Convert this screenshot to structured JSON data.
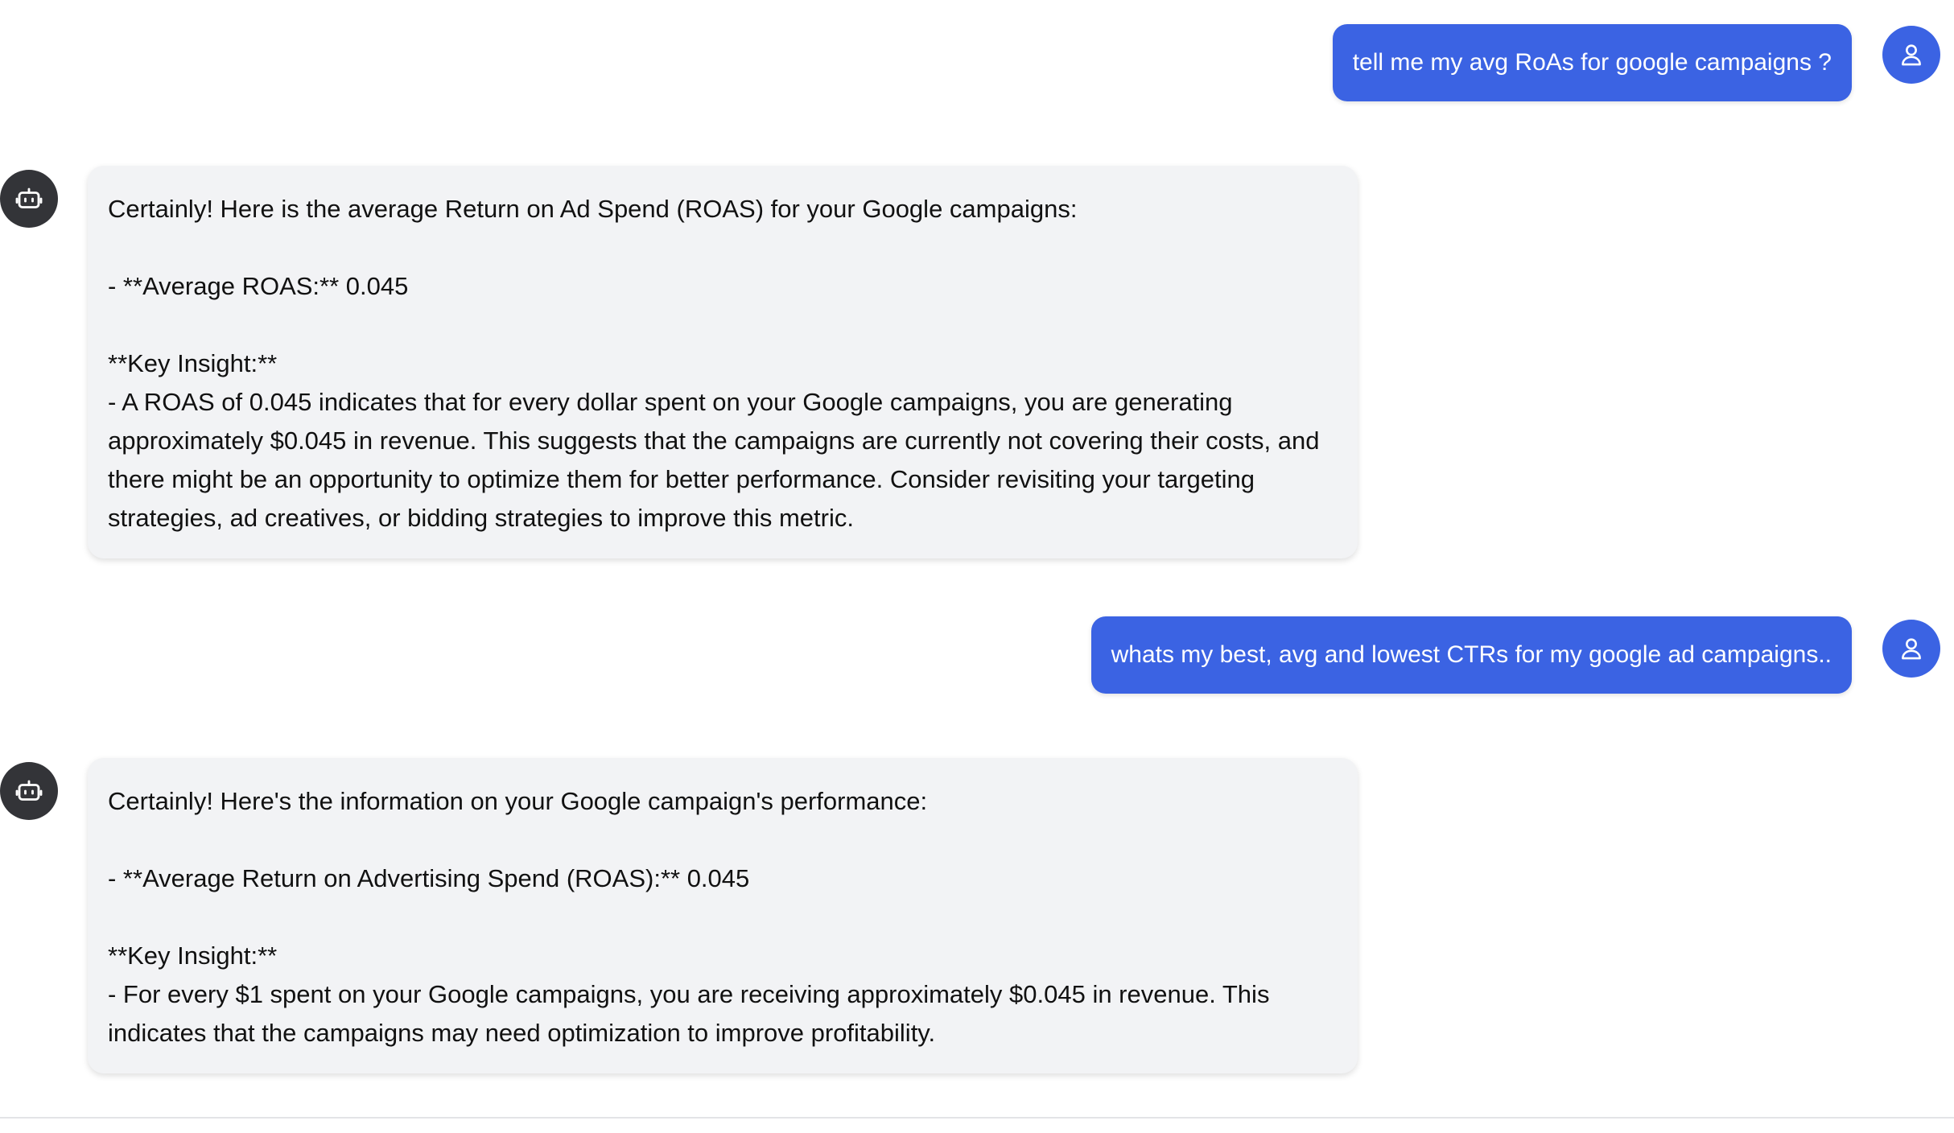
{
  "conversation": {
    "messages": [
      {
        "role": "user",
        "text": "tell me my avg RoAs for google campaigns ?"
      },
      {
        "role": "assistant",
        "paragraphs": [
          "Certainly! Here is the average Return on Ad Spend (ROAS) for your Google campaigns:",
          "- **Average ROAS:** 0.045",
          "**Key Insight:**\n- A ROAS of 0.045 indicates that for every dollar spent on your Google campaigns, you are generating approximately $0.045 in revenue. This suggests that the campaigns are currently not covering their costs, and there might be an opportunity to optimize them for better performance. Consider revisiting your targeting strategies, ad creatives, or bidding strategies to improve this metric."
        ]
      },
      {
        "role": "user",
        "text": "whats my best, avg and lowest CTRs for my google ad campaigns.."
      },
      {
        "role": "assistant",
        "paragraphs": [
          "Certainly! Here's the information on your Google campaign's performance:",
          "- **Average Return on Advertising Spend (ROAS):** 0.045",
          "**Key Insight:**\n- For every $1 spent on your Google campaigns, you are receiving approximately $0.045 in revenue. This indicates that the campaigns may need optimization to improve profitability."
        ]
      }
    ]
  },
  "icons": {
    "user_avatar": "user-icon",
    "bot_avatar": "robot-icon"
  },
  "colors": {
    "user_bubble": "#3b63e3",
    "bot_bubble": "#f2f3f5",
    "bot_avatar_bg": "#333438"
  }
}
